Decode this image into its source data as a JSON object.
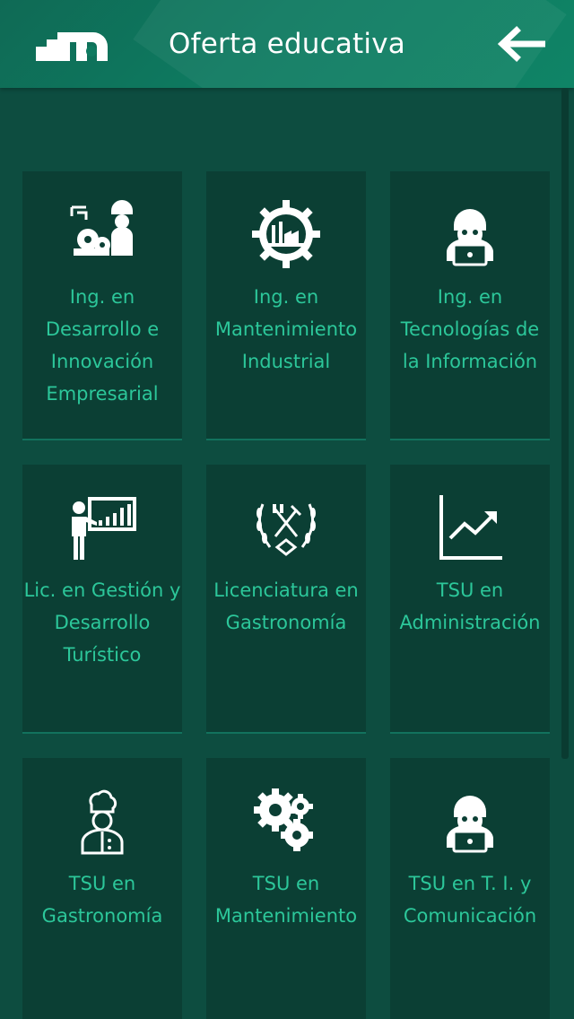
{
  "header": {
    "title": "Oferta educativa",
    "logo_icon": "institution-logo-icon",
    "back_icon": "arrow-left-icon"
  },
  "colors": {
    "header_bg": "#0f7a60",
    "page_bg": "#0d4d40",
    "card_bg": "#0b3f34",
    "label_text": "#2cc79a",
    "icon": "#ffffff"
  },
  "programs": [
    {
      "label": "Ing. en Desarrollo e Innovación Empresarial",
      "icon": "engineer-gears-icon"
    },
    {
      "label": "Ing. en Mantenimiento Industrial",
      "icon": "industrial-gear-factory-icon"
    },
    {
      "label": "Ing. en Tecnologías de la Información",
      "icon": "hacker-laptop-icon"
    },
    {
      "label": "Lic. en Gestión y Desarrollo Turístico",
      "icon": "presenter-chart-icon"
    },
    {
      "label": "Licenciatura en Gastronomía",
      "icon": "fork-knife-laurel-icon"
    },
    {
      "label": "TSU en Administración",
      "icon": "growth-chart-icon"
    },
    {
      "label": "TSU en Gastronomía",
      "icon": "chef-icon"
    },
    {
      "label": "TSU en Mantenimiento",
      "icon": "gears-icon"
    },
    {
      "label": "TSU en T. I. y Comunicación",
      "icon": "hacker-laptop-icon"
    }
  ]
}
